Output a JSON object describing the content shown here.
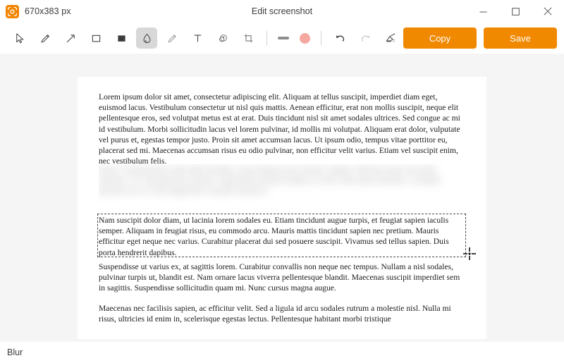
{
  "window": {
    "app_icon": "screenshot-app-icon",
    "dimension_label": "670x383 px",
    "title": "Edit screenshot",
    "controls": {
      "minimize": "minimize-icon",
      "maximize": "maximize-icon",
      "close": "close-icon"
    }
  },
  "toolbar": {
    "tools": [
      {
        "name": "select",
        "icon": "cursor-arrow-icon",
        "active": false
      },
      {
        "name": "pen",
        "icon": "pencil-icon",
        "active": false
      },
      {
        "name": "arrow",
        "icon": "arrow-icon",
        "active": false
      },
      {
        "name": "rectangle-outline",
        "icon": "square-outline-icon",
        "active": false
      },
      {
        "name": "rectangle-filled",
        "icon": "square-filled-icon",
        "active": false
      },
      {
        "name": "blur",
        "icon": "droplet-icon",
        "active": true
      },
      {
        "name": "highlighter",
        "icon": "marker-icon",
        "active": false
      },
      {
        "name": "text",
        "icon": "text-t-icon",
        "active": false
      },
      {
        "name": "step-number",
        "icon": "numbered-badge-icon",
        "active": false
      },
      {
        "name": "crop",
        "icon": "crop-icon",
        "active": false
      }
    ],
    "stroke_size": {
      "name": "stroke-size",
      "icon": "thickness-bar-icon"
    },
    "color": {
      "name": "color-swatch",
      "value": "#f5a8a0"
    },
    "undo": {
      "name": "undo",
      "icon": "undo-arrow-icon",
      "enabled": true
    },
    "redo": {
      "name": "redo",
      "icon": "redo-arrow-icon",
      "enabled": false
    },
    "clear": {
      "name": "clear-all",
      "icon": "eraser-icon",
      "enabled": true
    },
    "copy_label": "Copy",
    "save_label": "Save",
    "accent_color": "#f08800"
  },
  "document": {
    "paragraph_1": "Lorem ipsum dolor sit amet, consectetur adipiscing elit. Aliquam at tellus suscipit, imperdiet diam eget, euismod lacus. Vestibulum consectetur ut nisl quis mattis. Aenean efficitur, erat non mollis suscipit, neque elit pellentesque eros, sed volutpat metus est at erat. Duis tincidunt nisl sit amet sodales ultrices. Sed congue ac mi id vestibulum. Morbi sollicitudin lacus vel lorem pulvinar, id mollis mi volutpat. Aliquam erat dolor, vulputate vel purus et, egestas tempor justo. Proin sit amet accumsan lacus. Ut ipsum odio, tempus vitae porttitor eu, placerat sed mi. Maecenas accumsan risus eu odio pulvinar, non efficitur velit varius. Etiam vel suscipit enim, nec vestibulum felis.",
    "paragraph_2_blurred": "Donec euismod purus eget nibh tincidunt, vitae aliquam nunc dictum. Integer vehicula lorem non tellus pharetra, vel consequat arcu laoreet. Suspendisse potenti nullam ac tortor vitae purus faucibus. Curabitur gravida arcu ac tortor dignissim convallis aenean et.",
    "paragraph_3_selected": "Nam suscipit dolor diam, ut lacinia lorem sodales eu. Etiam tincidunt augue turpis, et feugiat sapien iaculis semper. Aliquam in feugiat risus, eu commodo arcu. Mauris mattis tincidunt sapien nec pretium. Mauris efficitur eget neque nec varius. Curabitur placerat dui sed posuere suscipit. Vivamus sed tellus sapien. Duis porta hendrerit dapibus.",
    "paragraph_4": "Suspendisse ut varius ex, at sagittis lorem. Curabitur convallis non neque nec tempus. Nullam a nisl sodales, pulvinar turpis ut, blandit est. Nam ornare lacus viverra pellentesque blandit. Maecenas suscipit imperdiet sem in sagittis. Suspendisse sollicitudin quam mi. Nunc cursus magna augue.",
    "paragraph_5": "Maecenas nec facilisis sapien, ac efficitur velit. Sed a ligula id arcu sodales rutrum a molestie nisl. Nulla mi risus, ultricies id enim in, scelerisque egestas lectus. Pellentesque habitant morbi tristique"
  },
  "status": {
    "label": "Blur"
  }
}
